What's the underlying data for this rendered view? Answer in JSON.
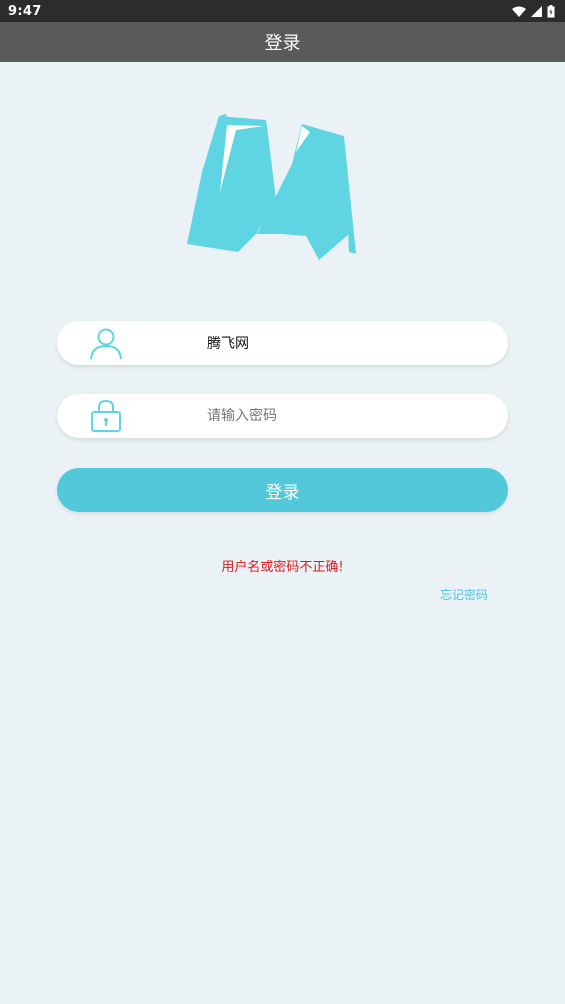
{
  "status_bar": {
    "time": "9:47"
  },
  "header": {
    "title": "登录"
  },
  "form": {
    "username": {
      "value": "腾飞网",
      "placeholder": ""
    },
    "password": {
      "value": "",
      "placeholder": "请输入密码"
    },
    "login_label": "登录"
  },
  "error_message": "用户名或密码不正确!",
  "forgot_password_label": "忘记密码",
  "colors": {
    "accent": "#52c9db",
    "logo": "#5fd5e4",
    "error": "#e01a1a",
    "background": "#eaf2f6",
    "title_bar": "#5a5a5a"
  },
  "icons": [
    "wifi-icon",
    "signal-icon",
    "battery-icon",
    "user-icon",
    "lock-icon"
  ]
}
